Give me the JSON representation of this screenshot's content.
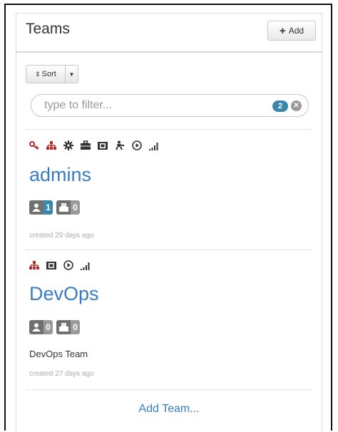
{
  "panel": {
    "title": "Teams",
    "add_label": "Add",
    "sort_label": "Sort",
    "filter": {
      "placeholder": "type to filter...",
      "count": "2"
    },
    "add_team_label": "Add Team..."
  },
  "teams": [
    {
      "name": "admins",
      "permission_icons": [
        "key-icon",
        "org-tree-icon",
        "gear-icon",
        "briefcase-icon",
        "camera-icon",
        "deploy-icon",
        "play-circle-icon",
        "signal-icon"
      ],
      "user_count": "1",
      "robot_count": "0",
      "description": "",
      "created": "created 29 days ago"
    },
    {
      "name": "DevOps",
      "permission_icons": [
        "org-tree-icon",
        "camera-icon",
        "play-circle-icon",
        "signal-icon"
      ],
      "user_count": "0",
      "robot_count": "0",
      "description": "DevOps Team",
      "created": "created 27 days ago"
    }
  ],
  "colors": {
    "accent": "#3a7cc0",
    "icon_red": "#b52b27",
    "badge_blue": "#3a87ad"
  }
}
